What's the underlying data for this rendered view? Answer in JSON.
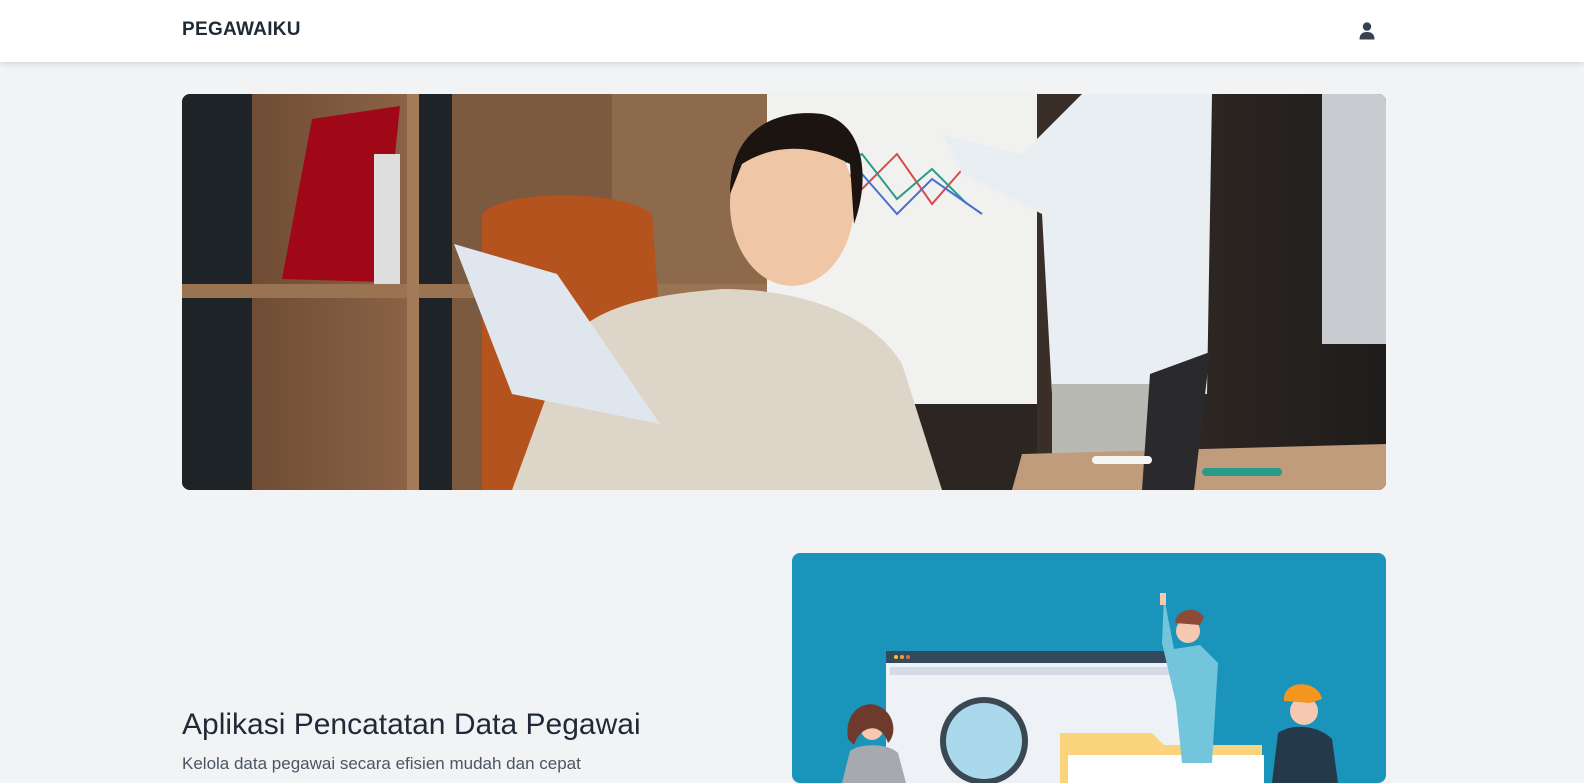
{
  "navbar": {
    "brand": "PEGAWAIKU",
    "user_icon": "user-icon"
  },
  "hero": {
    "image_icon": "office-photo"
  },
  "main": {
    "title": "Aplikasi Pencatatan Data Pegawai",
    "description": "Kelola data pegawai secara efisien mudah dan cepat",
    "illustration_icon": "data-search-illustration"
  },
  "colors": {
    "navbar_bg": "#ffffff",
    "page_bg": "#f2f3f5",
    "brand_text": "#1f2a37",
    "illustration_bg": "#1b94bb"
  }
}
